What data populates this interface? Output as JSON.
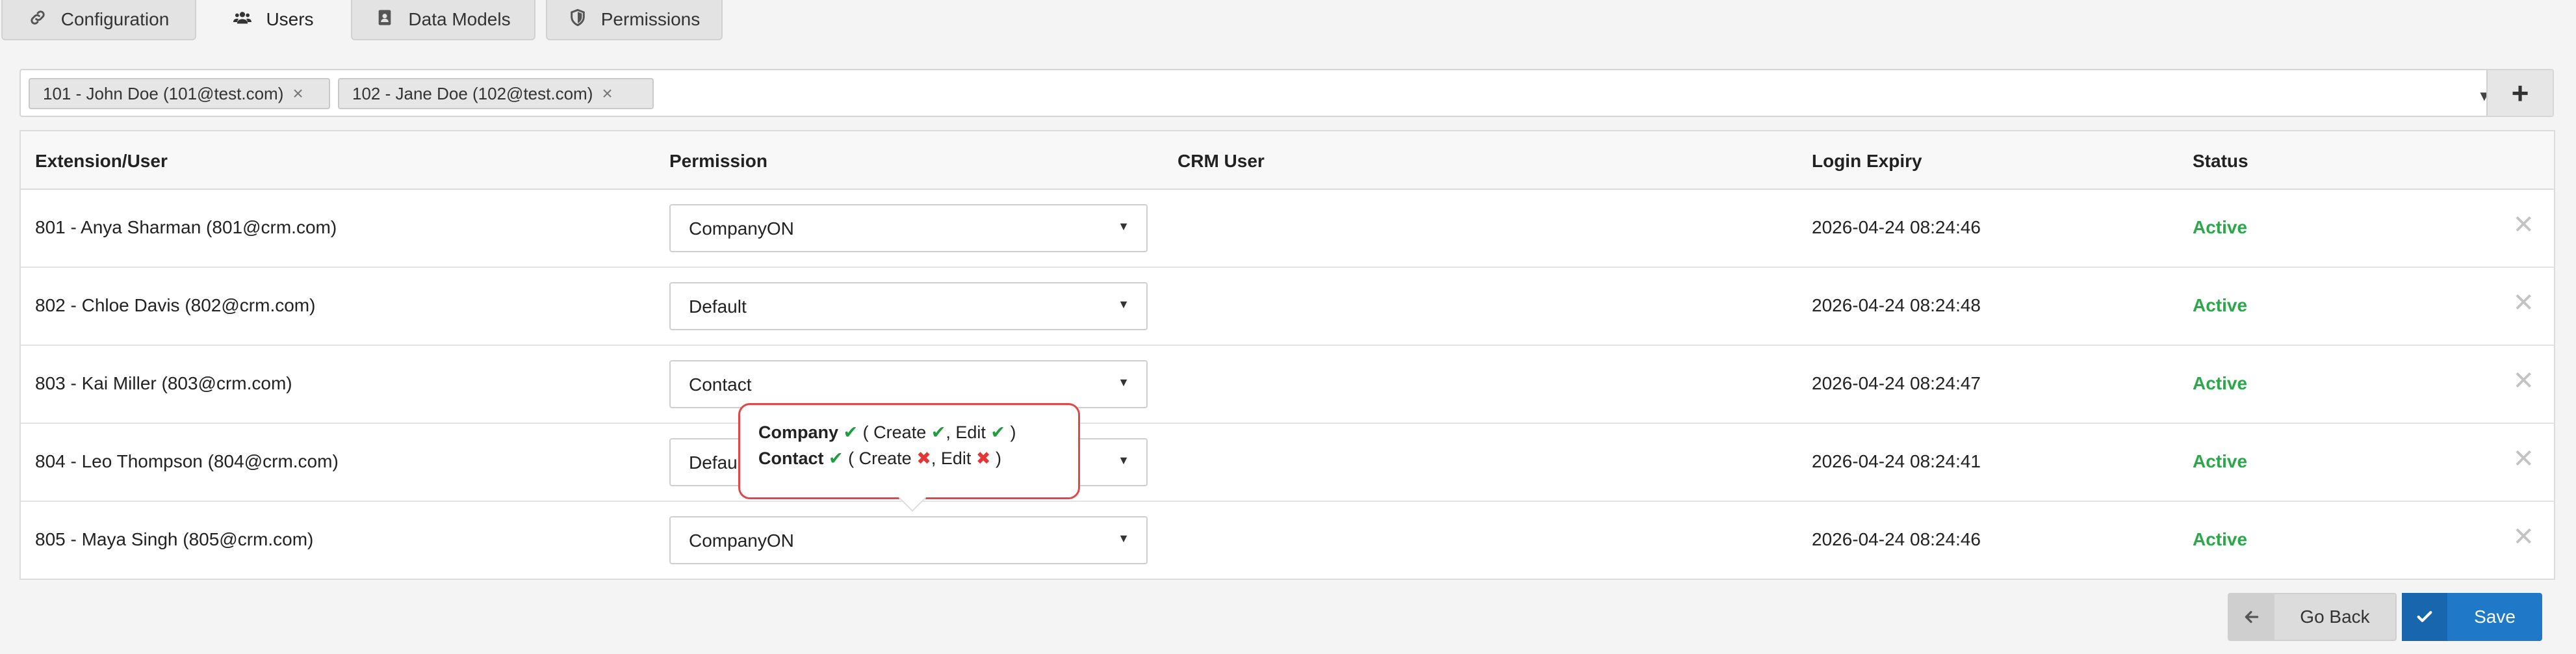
{
  "tabs": [
    {
      "label": "Configuration",
      "icon": "link-icon"
    },
    {
      "label": "Users",
      "icon": "users-icon"
    },
    {
      "label": "Data Models",
      "icon": "address-book-icon"
    },
    {
      "label": "Permissions",
      "icon": "shield-icon"
    }
  ],
  "selector": {
    "chips": [
      "101 - John Doe (101@test.com)",
      "102 - Jane Doe (102@test.com)"
    ],
    "add_label": "+"
  },
  "table": {
    "headers": [
      "Extension/User",
      "Permission",
      "CRM User",
      "Login Expiry",
      "Status"
    ],
    "rows": [
      {
        "user": "801 - Anya Sharman (801@crm.com)",
        "permission": "CompanyON",
        "crm_user": "",
        "expiry": "2026-04-24 08:24:46",
        "status": "Active"
      },
      {
        "user": "802 - Chloe Davis (802@crm.com)",
        "permission": "Default",
        "crm_user": "",
        "expiry": "2026-04-24 08:24:48",
        "status": "Active"
      },
      {
        "user": "803 - Kai Miller (803@crm.com)",
        "permission": "Contact",
        "crm_user": "",
        "expiry": "2026-04-24 08:24:47",
        "status": "Active"
      },
      {
        "user": "804 - Leo Thompson (804@crm.com)",
        "permission": "Defau",
        "crm_user": "",
        "expiry": "2026-04-24 08:24:41",
        "status": "Active"
      },
      {
        "user": "805 - Maya Singh (805@crm.com)",
        "permission": "CompanyON",
        "crm_user": "",
        "expiry": "2026-04-24 08:24:46",
        "status": "Active"
      }
    ]
  },
  "tooltip": {
    "line1_model": "Company",
    "line1_create": "Create",
    "line1_edit": "Edit",
    "line2_model": "Contact",
    "line2_create": "Create",
    "line2_edit": "Edit"
  },
  "buttons": {
    "back": "Go Back",
    "save": "Save"
  },
  "colors": {
    "accent": "#1f78c8",
    "active": "#2aa84a",
    "ok": "#1e9e3e",
    "error": "#e53535"
  }
}
